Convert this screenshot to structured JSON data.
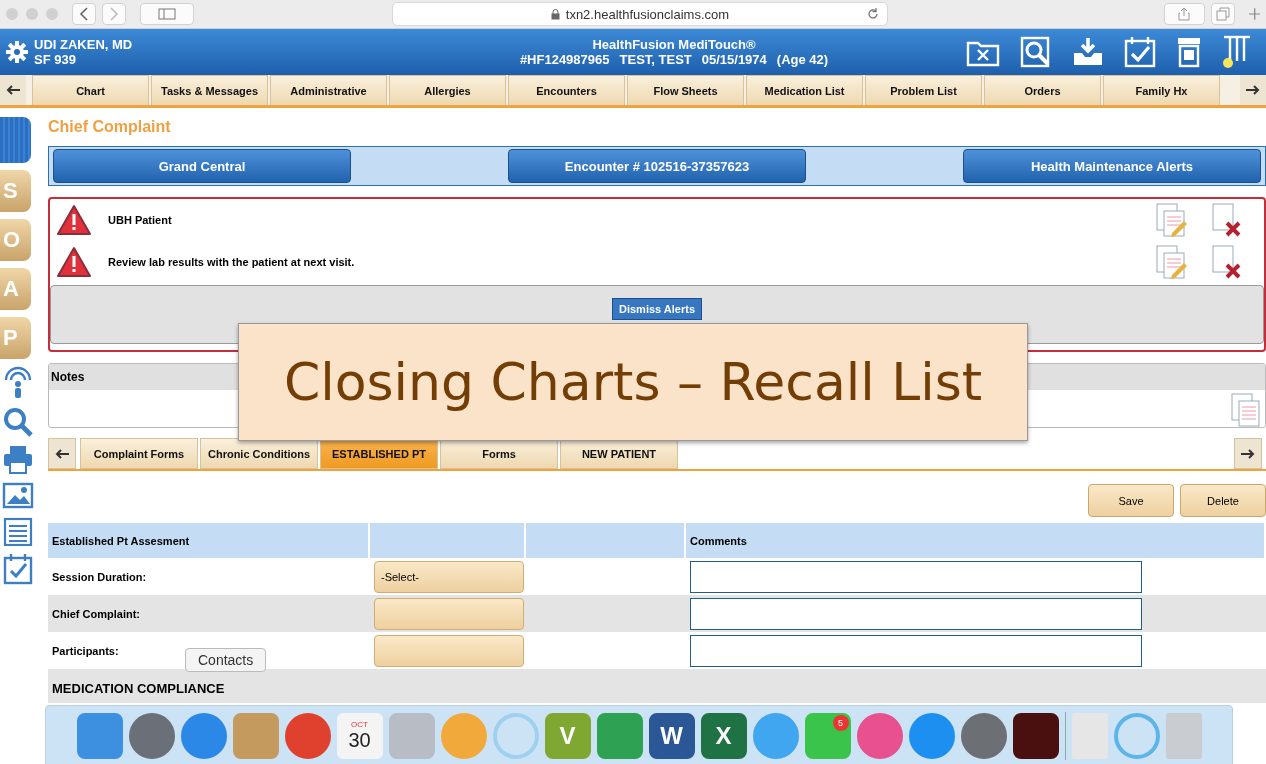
{
  "browser": {
    "url": "txn2.healthfusionclaims.com"
  },
  "header": {
    "provider": "UDI ZAKEN, MD",
    "code": "SF 939",
    "app_title": "HealthFusion MediTouch®",
    "patient_id": "#HF124987965",
    "patient_name": "TEST, TEST",
    "dob": "05/15/1974",
    "age": "(Age 42)"
  },
  "main_tabs": [
    "Chart",
    "Tasks & Messages",
    "Administrative",
    "Allergies",
    "Encounters",
    "Flow Sheets",
    "Medication List",
    "Problem List",
    "Orders",
    "Family Hx"
  ],
  "soap_letters": [
    "S",
    "O",
    "A",
    "P"
  ],
  "page_title": "Chief Complaint",
  "nav_buttons": [
    "Grand Central",
    "Encounter # 102516-37357623",
    "Health Maintenance Alerts"
  ],
  "alerts": [
    {
      "text": "UBH Patient"
    },
    {
      "text": "Review lab results with the patient at next visit."
    }
  ],
  "dismiss_button": "Dismiss Alerts",
  "notes": {
    "label": "Notes"
  },
  "sub_tabs": [
    {
      "label": "Complaint Forms",
      "selected": false
    },
    {
      "label": "Chronic Conditions",
      "selected": false
    },
    {
      "label": "ESTABLISHED PT",
      "selected": true
    },
    {
      "label": "Forms",
      "selected": false
    },
    {
      "label": "NEW PATIENT",
      "selected": false
    }
  ],
  "actions": [
    "Save",
    "Delete"
  ],
  "form": {
    "heading": "Established Pt Assesment",
    "comments_heading": "Comments",
    "rows": [
      {
        "label": "Session Duration:",
        "select": "-Select-"
      },
      {
        "label": "Chief Complaint:"
      },
      {
        "label": "Participants:"
      }
    ],
    "section": "MEDICATION COMPLIANCE"
  },
  "tooltip": "Contacts",
  "caption": "Closing Charts – Recall List",
  "dock": [
    {
      "kind": "tile",
      "color": "#3d8fe0"
    },
    {
      "kind": "round",
      "color": "#6b6f78"
    },
    {
      "kind": "round",
      "color": "#2b88e6"
    },
    {
      "kind": "tile",
      "color": "#c49a5e"
    },
    {
      "kind": "round",
      "color": "#e0412f"
    },
    {
      "kind": "calendar",
      "color": "#f4f4f4",
      "text": "30",
      "subtext": "OCT"
    },
    {
      "kind": "tile",
      "color": "#b8bcc4"
    },
    {
      "kind": "round",
      "color": "#f2a93b"
    },
    {
      "kind": "ring",
      "color": "#9fd0ef"
    },
    {
      "kind": "tile",
      "color": "#7fa832",
      "text": "V"
    },
    {
      "kind": "tile",
      "color": "#2fa152"
    },
    {
      "kind": "tile",
      "color": "#2b5797",
      "text": "W"
    },
    {
      "kind": "tile",
      "color": "#1f7244",
      "text": "X"
    },
    {
      "kind": "round",
      "color": "#41a6f0"
    },
    {
      "kind": "tile",
      "color": "#3bc44b",
      "badge": "5"
    },
    {
      "kind": "round",
      "color": "#e8508f"
    },
    {
      "kind": "round",
      "color": "#1d8ff0"
    },
    {
      "kind": "round",
      "color": "#6c6f74"
    },
    {
      "kind": "tile",
      "color": "#4a1010"
    },
    {
      "kind": "doc",
      "color": "#e6e6e6"
    },
    {
      "kind": "ring",
      "color": "#5db4e8"
    },
    {
      "kind": "doc",
      "color": "#c9cdd2"
    }
  ]
}
